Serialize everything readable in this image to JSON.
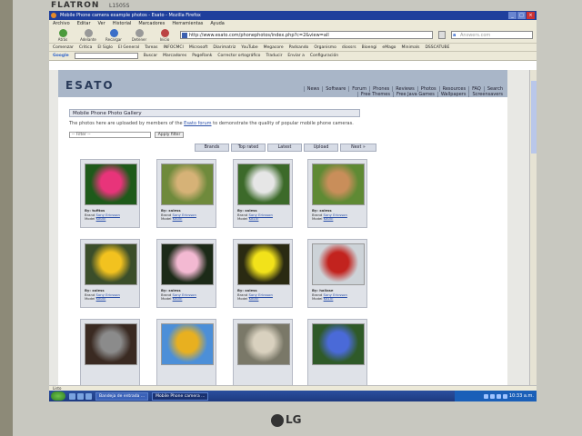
{
  "monitor": {
    "brand_top": "FLATRON",
    "model": "L1505S",
    "brand_bottom": "LG"
  },
  "browser": {
    "title": "Mobile Phone camera example photos - Esato - Mozilla Firefox",
    "menu": [
      "Archivo",
      "Editar",
      "Ver",
      "Historial",
      "Marcadores",
      "Herramientas",
      "Ayuda"
    ],
    "nav_buttons": [
      "Atrás",
      "Adelante",
      "Recargar",
      "Detener",
      "Inicio"
    ],
    "url": "http://www.esato.com/phonephotos/index.php?c=2&view=all",
    "search_placeholder": "Answers.com",
    "bookmarks": [
      "Comenzar",
      "Critica",
      "El Siglo",
      "El General",
      "Tareas",
      "INFOCMCI",
      "Microsoft",
      "Diarimatriz",
      "YouTube",
      "Megacore",
      "Padsando",
      "Organismo",
      "diossrs",
      "Bioengi",
      "eMago",
      "Minimals",
      "DSSCATUBE"
    ],
    "google_bar": [
      "Google",
      "Buscar",
      "Marcadores",
      "PageRank",
      "Corrector ortográfico",
      "Traducir",
      "Enviar a",
      "Configuración"
    ]
  },
  "site": {
    "logo": "ESATO",
    "nav_row1": [
      "News",
      "Software",
      "Forum",
      "Phones",
      "Reviews",
      "Photos",
      "Resources",
      "FAQ",
      "Search"
    ],
    "nav_row2": [
      "Free Themes",
      "Free Java Games",
      "Wallpapers",
      "Screensavers"
    ],
    "gallery_title": "Mobile Phone Photo Gallery",
    "intro_before": "The photos here are uploaded by members of the ",
    "intro_link": "Esato forum",
    "intro_after": " to demonstrate the quality of popular mobile phone cameras.",
    "filter_value": "-- Filter --",
    "apply_label": "Apply filter",
    "tabs": [
      "Brands",
      "Top rated",
      "Latest",
      "Upload",
      "Next »"
    ]
  },
  "photos": [
    {
      "by": "By: tufitos",
      "brand": "Sony Ericsson",
      "model": "K800i",
      "colors": [
        "#1e5a1a",
        "#e8347a"
      ]
    },
    {
      "by": "By: xaless",
      "brand": "Sony Ericsson",
      "model": "K800i",
      "colors": [
        "#6f8a3c",
        "#d6b277"
      ]
    },
    {
      "by": "By: xaless",
      "brand": "Sony Ericsson",
      "model": "K810i",
      "colors": [
        "#3c6a2a",
        "#e6e6e6"
      ]
    },
    {
      "by": "By: xaless",
      "brand": "Sony Ericsson",
      "model": "K800i",
      "colors": [
        "#5f8a34",
        "#c98e5a"
      ]
    },
    {
      "by": "By: xaless",
      "brand": "Sony Ericsson",
      "model": "K800i",
      "colors": [
        "#3b4e2a",
        "#f2c21f"
      ]
    },
    {
      "by": "By: xaless",
      "brand": "Sony Ericsson",
      "model": "K800i",
      "colors": [
        "#1c2a18",
        "#f3b9d2"
      ]
    },
    {
      "by": "By: xaless",
      "brand": "Sony Ericsson",
      "model": "K800i",
      "colors": [
        "#2a2a12",
        "#f2e21a"
      ]
    },
    {
      "by": "By: hallase",
      "brand": "Sony Ericsson",
      "model": "K810i",
      "colors": [
        "#cdd3d8",
        "#c2231e"
      ]
    },
    {
      "by": "",
      "brand": "",
      "model": "",
      "colors": [
        "#3a2a22",
        "#8b8b8b"
      ]
    },
    {
      "by": "",
      "brand": "",
      "model": "",
      "colors": [
        "#4c8fd8",
        "#e8b020"
      ]
    },
    {
      "by": "",
      "brand": "",
      "model": "",
      "colors": [
        "#7a7868",
        "#d9d1bf"
      ]
    },
    {
      "by": "",
      "brand": "",
      "model": "",
      "colors": [
        "#2f5a28",
        "#4a6ad8"
      ]
    }
  ],
  "status_text": "Listo",
  "taskbar": {
    "items": [
      "Bandeja de entrada ...",
      "Mobile Phone camera ..."
    ],
    "clock": "10:33 a.m."
  }
}
